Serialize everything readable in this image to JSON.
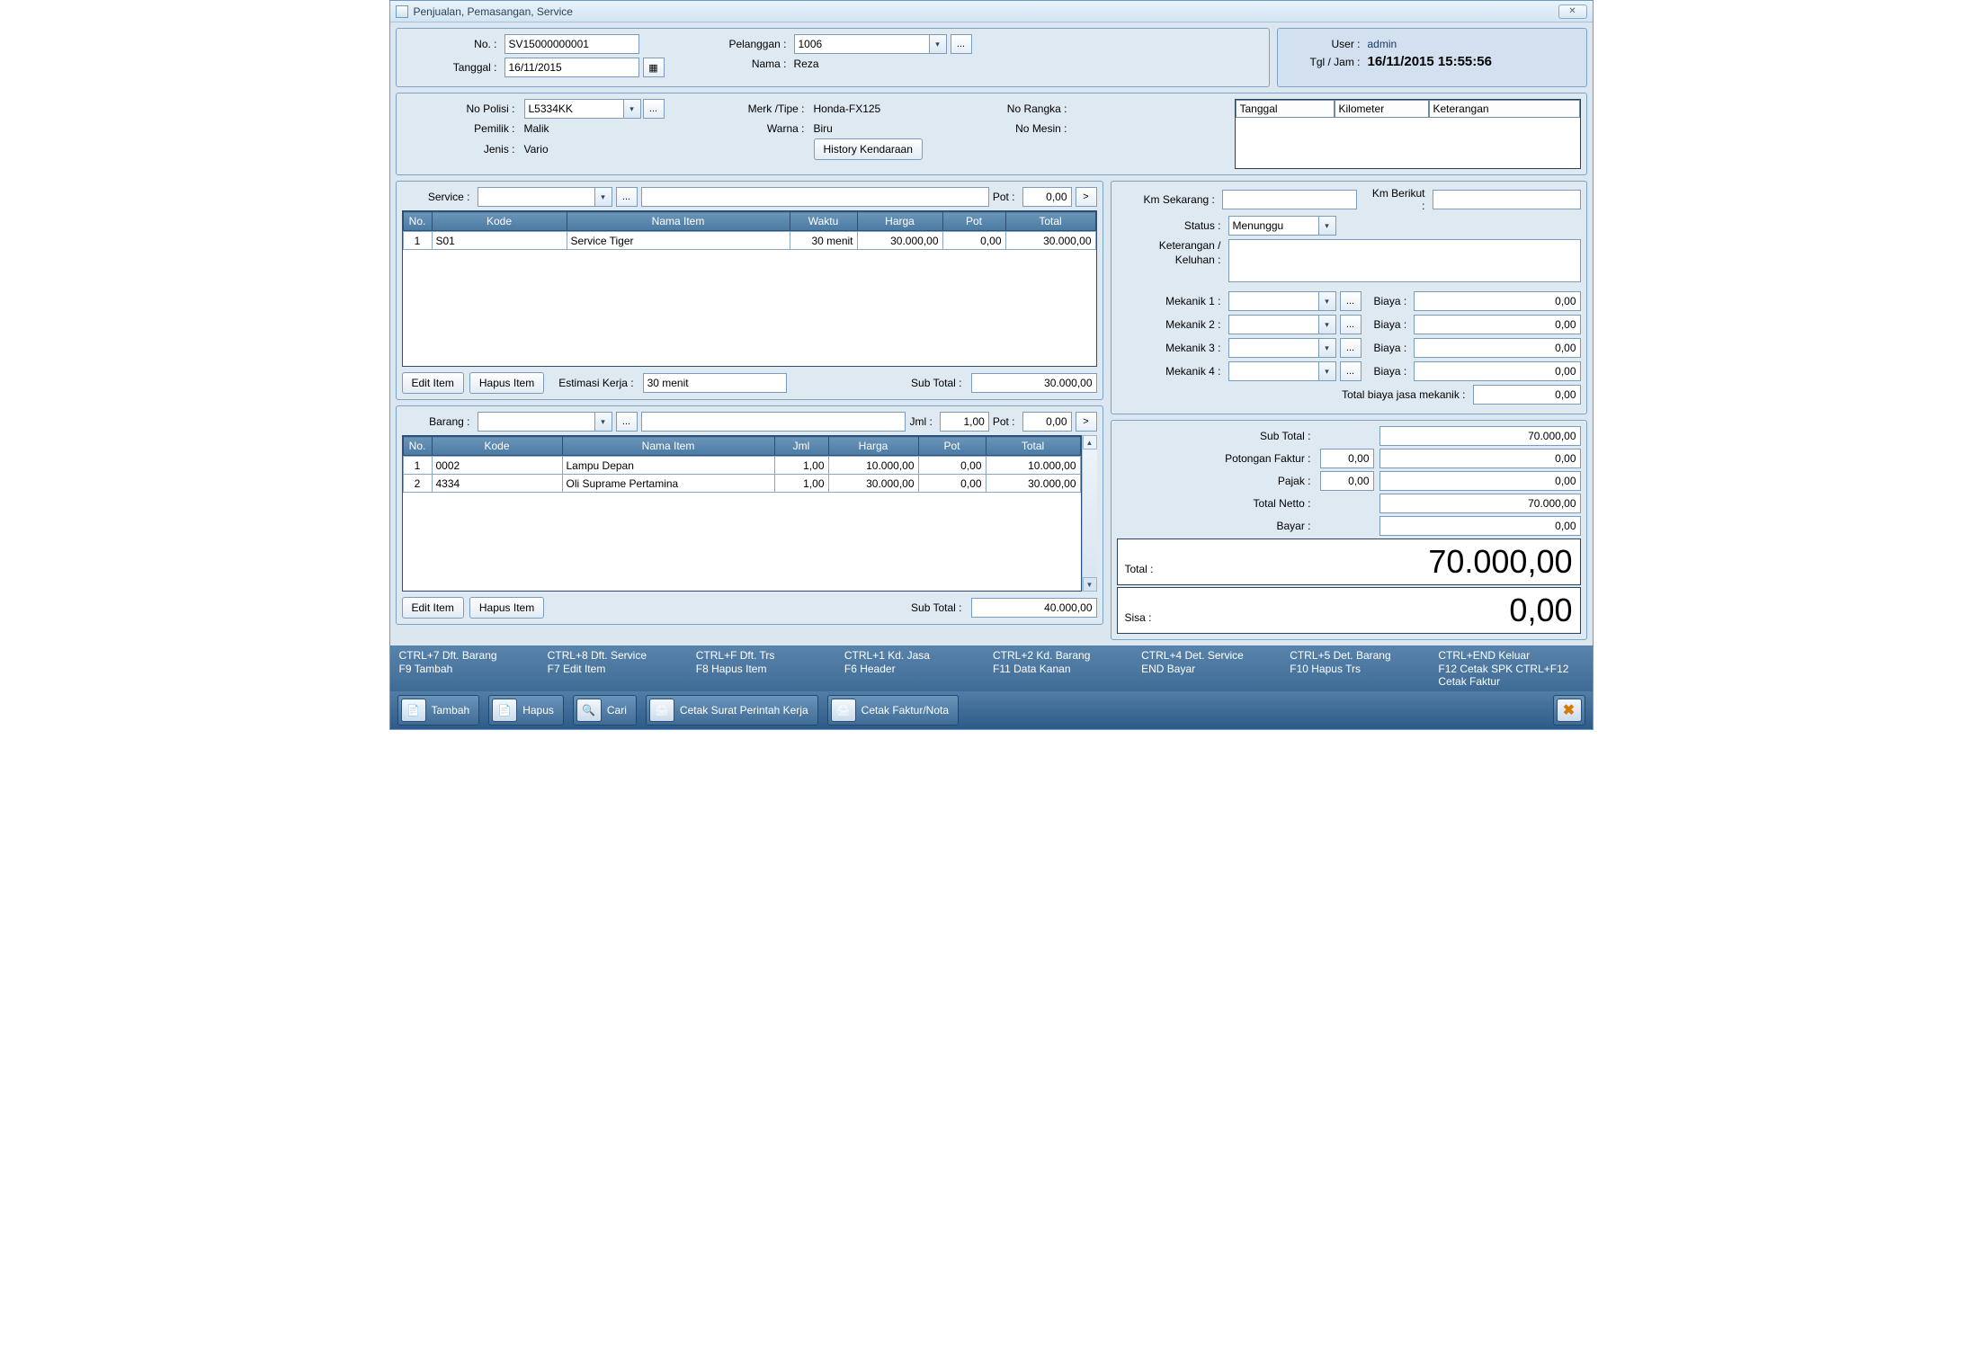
{
  "window": {
    "title": "Penjualan, Pemasangan, Service"
  },
  "header": {
    "no_label": "No. :",
    "no_value": "SV15000000001",
    "tanggal_label": "Tanggal :",
    "tanggal_value": "16/11/2015",
    "pelanggan_label": "Pelanggan :",
    "pelanggan_value": "1006",
    "nama_label": "Nama :",
    "nama_value": "Reza"
  },
  "userbox": {
    "user_label": "User :",
    "user_value": "admin",
    "datetime_label": "Tgl / Jam :",
    "datetime_value": "16/11/2015 15:55:56"
  },
  "vehicle": {
    "nopolisi_label": "No Polisi :",
    "nopolisi_value": "L5334KK",
    "pemilik_label": "Pemilik :",
    "pemilik_value": "Malik",
    "jenis_label": "Jenis :",
    "jenis_value": "Vario",
    "merk_label": "Merk /Tipe :",
    "merk_value": "Honda-FX125",
    "warna_label": "Warna :",
    "warna_value": "Biru",
    "norangka_label": "No Rangka :",
    "norangka_value": "",
    "nomesin_label": "No Mesin :",
    "nomesin_value": "",
    "history_btn": "History Kendaraan",
    "table_headers": {
      "tanggal": "Tanggal",
      "kilometer": "Kilometer",
      "keterangan": "Keterangan"
    }
  },
  "service_section": {
    "service_label": "Service :",
    "pot_label": "Pot :",
    "pot_value": "0,00",
    "columns": {
      "no": "No.",
      "kode": "Kode",
      "nama": "Nama Item",
      "waktu": "Waktu",
      "harga": "Harga",
      "pot": "Pot",
      "total": "Total"
    },
    "rows": [
      {
        "no": "1",
        "kode": "S01",
        "nama": "Service Tiger",
        "waktu": "30 menit",
        "harga": "30.000,00",
        "pot": "0,00",
        "total": "30.000,00"
      }
    ],
    "edit_btn": "Edit Item",
    "hapus_btn": "Hapus Item",
    "estimasi_label": "Estimasi Kerja :",
    "estimasi_value": "30 menit",
    "subtotal_label": "Sub Total :",
    "subtotal_value": "30.000,00"
  },
  "barang_section": {
    "barang_label": "Barang :",
    "jml_label": "Jml :",
    "jml_value": "1,00",
    "pot_label": "Pot :",
    "pot_value": "0,00",
    "columns": {
      "no": "No.",
      "kode": "Kode",
      "nama": "Nama Item",
      "jml": "Jml",
      "harga": "Harga",
      "pot": "Pot",
      "total": "Total"
    },
    "rows": [
      {
        "no": "1",
        "kode": "0002",
        "nama": "Lampu Depan",
        "jml": "1,00",
        "harga": "10.000,00",
        "pot": "0,00",
        "total": "10.000,00"
      },
      {
        "no": "2",
        "kode": "4334",
        "nama": "Oli Suprame Pertamina",
        "jml": "1,00",
        "harga": "30.000,00",
        "pot": "0,00",
        "total": "30.000,00"
      }
    ],
    "edit_btn": "Edit Item",
    "hapus_btn": "Hapus Item",
    "subtotal_label": "Sub Total :",
    "subtotal_value": "40.000,00"
  },
  "right_panel": {
    "km_sekarang_label": "Km Sekarang :",
    "km_sekarang_value": "",
    "km_berikut_label": "Km Berikut :",
    "km_berikut_value": "",
    "status_label": "Status :",
    "status_value": "Menunggu",
    "keterangan_label1": "Keterangan /",
    "keterangan_label2": "Keluhan :",
    "mek1_label": "Mekanik 1 :",
    "mek2_label": "Mekanik 2 :",
    "mek3_label": "Mekanik 3 :",
    "mek4_label": "Mekanik 4 :",
    "biaya_label": "Biaya :",
    "biaya1": "0,00",
    "biaya2": "0,00",
    "biaya3": "0,00",
    "biaya4": "0,00",
    "total_biaya_label": "Total biaya jasa mekanik :",
    "total_biaya_value": "0,00"
  },
  "totals": {
    "subtotal_label": "Sub Total :",
    "subtotal_value": "70.000,00",
    "potongan_label": "Potongan Faktur :",
    "potongan_pct": "0,00",
    "potongan_value": "0,00",
    "pajak_label": "Pajak :",
    "pajak_pct": "0,00",
    "pajak_value": "0,00",
    "netto_label": "Total Netto :",
    "netto_value": "70.000,00",
    "bayar_label": "Bayar :",
    "bayar_value": "0,00",
    "total_label": "Total :",
    "total_value": "70.000,00",
    "sisa_label": "Sisa :",
    "sisa_value": "0,00"
  },
  "shortcuts": [
    "CTRL+7 Dft. Barang",
    "CTRL+8 Dft. Service",
    "CTRL+F Dft. Trs",
    "CTRL+1 Kd. Jasa",
    "CTRL+2 Kd. Barang",
    "CTRL+4 Det. Service",
    "CTRL+5 Det. Barang",
    "CTRL+END Keluar",
    "F9 Tambah",
    "F7 Edit Item",
    "F8 Hapus Item",
    "F6 Header",
    "F11 Data Kanan",
    "END Bayar",
    "F10 Hapus Trs",
    "F12 Cetak SPK  CTRL+F12 Cetak Faktur"
  ],
  "toolbar": {
    "tambah": "Tambah",
    "hapus": "Hapus",
    "cari": "Cari",
    "cetak_spk": "Cetak Surat Perintah Kerja",
    "cetak_faktur": "Cetak Faktur/Nota"
  },
  "glyph": {
    "ellipsis": "...",
    "chevron": "▾",
    "gt": ">",
    "x": "✕",
    "cal": "▦"
  }
}
